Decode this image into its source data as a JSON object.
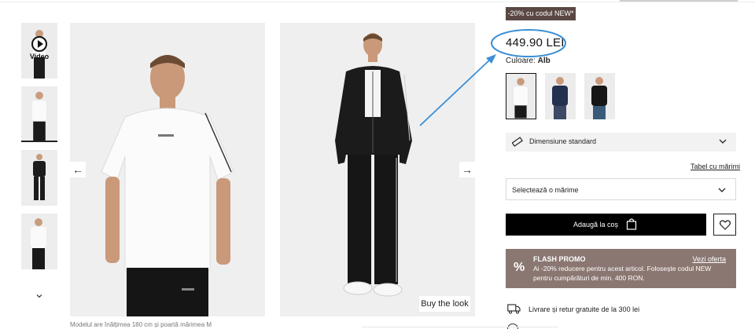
{
  "gallery": {
    "video_label": "Video",
    "thumbnail_count": 4,
    "caption": "Modelul are înălțimea 180 cm și poartă mărimea M",
    "buy_the_look": "Buy the look",
    "prev_icon": "arrow-left-icon",
    "next_icon": "arrow-right-icon"
  },
  "product": {
    "promo_badge": "-20% cu codul NEW*",
    "price": "449.90 LEI",
    "color_label": "Culoare:",
    "color_value": "Alb",
    "swatches": [
      "white",
      "navy",
      "black"
    ],
    "size_fit": "Dimensiune standard",
    "size_table_link": "Tabel cu mărimi",
    "size_select_placeholder": "Selectează o mărime",
    "add_to_cart": "Adaugă la coș",
    "flash_promo": {
      "percent_symbol": "%",
      "title": "FLASH PROMO",
      "offer_link": "Vezi oferta",
      "body": "Ai -20% reducere pentru acest articol. Folosește codul NEW pentru cumpărături de min. 400 RON."
    },
    "delivery_text": "Livrare și retur gratuite de la 300 lei"
  },
  "colors": {
    "promo_badge_bg": "#5a4743",
    "flash_bg": "#8b7772",
    "cart_bg": "#000000",
    "annotation": "#3a8fd6"
  }
}
